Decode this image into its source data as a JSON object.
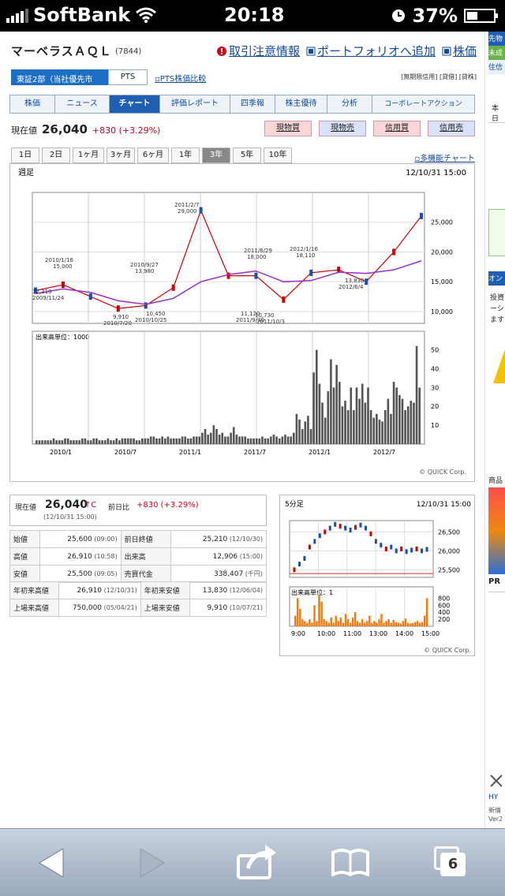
{
  "status": {
    "carrier": "SoftBank",
    "time": "20:18",
    "battery": "37%"
  },
  "stock": {
    "name": "マーベラスＡＱＬ",
    "code": "(7844)"
  },
  "toplinks": [
    "取引注意情報",
    "ポートフォリオへ追加",
    "株価"
  ],
  "market": {
    "active": "東証2部（当社優先市場）",
    "alt": "PTS",
    "compare": "PTS株価比較",
    "tags": "[無期限信用]  [貸借]  [貸株]"
  },
  "tabs": [
    "株価",
    "ニュース",
    "チャート",
    "評価レポート",
    "四季報",
    "株主優待",
    "分析",
    "コーポレートアクション"
  ],
  "price": {
    "label": "現在値",
    "value": "26,040",
    "change": "+830 (+3.29%)"
  },
  "trade_buttons": [
    "現物買",
    "現物売",
    "信用買",
    "信用売"
  ],
  "ranges": [
    "1日",
    "2日",
    "1ヶ月",
    "3ヶ月",
    "6ヶ月",
    "1年",
    "3年",
    "5年",
    "10年"
  ],
  "multi_chart": "多機能チャート",
  "weekly": {
    "label": "週足",
    "date": "12/10/31 15:00",
    "copyright": "© QUICK Corp.",
    "volume_label": "出来高単位：1000",
    "annotations": [
      "2011/2/7",
      "29,000",
      "2010/1/16",
      "15,000",
      "2010/9/27",
      "13,980",
      "2011/8/29",
      "18,000",
      "2012/1/16",
      "18,110",
      "12,310",
      "2009/11/24",
      "9,910",
      "2010/7/20",
      "10,450",
      "2010/10/25",
      "11,120",
      "2011/9/30",
      "10,730",
      "2011/10/3",
      "13,830",
      "2012/6/4"
    ]
  },
  "chart_data": [
    {
      "type": "line",
      "name": "weekly-price",
      "x": [
        "2009/11",
        "2010/1",
        "2010/4",
        "2010/7",
        "2010/10",
        "2011/1",
        "2011/2",
        "2011/4",
        "2011/7",
        "2011/10",
        "2012/1",
        "2012/4",
        "2012/6",
        "2012/8",
        "2012/10"
      ],
      "series": [
        {
          "values": [
            13500,
            14500,
            12500,
            10500,
            11000,
            14000,
            27000,
            16000,
            16000,
            12000,
            16500,
            17000,
            15000,
            20000,
            26040
          ]
        },
        {
          "values": [
            13000,
            13800,
            13200,
            11800,
            11200,
            12200,
            15000,
            16200,
            16800,
            15000,
            15200,
            16600,
            16400,
            17000,
            18500
          ]
        }
      ],
      "ylim": [
        8000,
        30000
      ],
      "yticks": [
        "25,000",
        "20,000",
        "15,000",
        "10,000"
      ],
      "xticks": [
        "2010/1",
        "2010/7",
        "2011/1",
        "2011/7",
        "2012/1",
        "2012/7"
      ]
    },
    {
      "type": "bar",
      "name": "weekly-volume",
      "values": [
        2,
        2,
        2,
        2,
        2,
        2,
        3,
        2,
        2,
        2,
        3,
        3,
        2,
        2,
        2,
        2,
        3,
        3,
        2,
        2,
        3,
        3,
        2,
        2,
        2,
        3,
        2,
        2,
        3,
        2,
        3,
        3,
        3,
        3,
        3,
        2,
        2,
        3,
        3,
        3,
        4,
        4,
        3,
        3,
        4,
        3,
        4,
        3,
        3,
        3,
        3,
        4,
        4,
        3,
        3,
        4,
        4,
        4,
        6,
        8,
        5,
        6,
        10,
        8,
        5,
        6,
        4,
        4,
        6,
        9,
        5,
        4,
        4,
        4,
        3,
        3,
        3,
        3,
        3,
        4,
        3,
        3,
        4,
        5,
        4,
        3,
        4,
        5,
        4,
        4,
        6,
        16,
        13,
        8,
        12,
        15,
        8,
        38,
        50,
        32,
        22,
        14,
        28,
        45,
        30,
        42,
        33,
        20,
        23,
        18,
        30,
        18,
        30,
        24,
        32,
        22,
        30,
        18,
        14,
        16,
        13,
        12,
        18,
        24,
        16,
        33,
        30,
        26,
        24,
        18,
        20,
        23,
        22,
        52,
        30
      ],
      "ylim": [
        0,
        54
      ],
      "yticks": [
        "50",
        "40",
        "30",
        "20",
        "10"
      ]
    },
    {
      "type": "line",
      "name": "5min-price",
      "values": [
        25500,
        25650,
        25800,
        26100,
        26250,
        26400,
        26500,
        26600,
        26700,
        26650,
        26600,
        26550,
        26620,
        26680,
        26600,
        26450,
        26250,
        26150,
        26050,
        26100,
        26000,
        26050,
        25980,
        26020,
        26050,
        26000,
        26040
      ],
      "ylim": [
        25300,
        26800
      ],
      "yticks": [
        "26,500",
        "26,000",
        "25,500"
      ],
      "xticks": [
        "9:00",
        "10:00",
        "11:00",
        "13:00",
        "14:00",
        "15:00"
      ]
    },
    {
      "type": "bar",
      "name": "5min-volume",
      "values": [
        300,
        800,
        500,
        200,
        150,
        100,
        200,
        100,
        600,
        150,
        900,
        700,
        200,
        150,
        100,
        250,
        100,
        300,
        150,
        250,
        100,
        350,
        200,
        100,
        250,
        400,
        150,
        100,
        200,
        100,
        150,
        300,
        100,
        150,
        100,
        200,
        350,
        100,
        150,
        200,
        100,
        180,
        120,
        100,
        80,
        150,
        220,
        100,
        80,
        90,
        120,
        150,
        100,
        120,
        300,
        800
      ],
      "ylim": [
        0,
        900
      ],
      "yticks": [
        "800",
        "600",
        "400",
        "200"
      ]
    }
  ],
  "quote": {
    "now_label": "現在値",
    "now": "26,040",
    "mark": "↑C",
    "time": "(12/10/31 15:00)",
    "prev_label": "前日比",
    "prev": "+830 (+3.29%)"
  },
  "table1": [
    {
      "l1": "始値",
      "v1": "25,600",
      "t1": "(09:00)",
      "l2": "前日終値",
      "v2": "25,210",
      "t2": "(12/10/30)"
    },
    {
      "l1": "高値",
      "v1": "26,910",
      "t1": "(10:58)",
      "l2": "出来高",
      "v2": "12,906",
      "t2": "(15:00)"
    },
    {
      "l1": "安値",
      "v1": "25,500",
      "t1": "(09:05)",
      "l2": "売買代金",
      "v2": "338,407",
      "t2": "(千円)"
    }
  ],
  "table2": [
    {
      "l1": "年初来高値",
      "v1": "26,910",
      "t1": "(12/10/31)",
      "l2": "年初来安値",
      "v2": "13,830",
      "t2": "(12/06/04)"
    },
    {
      "l1": "上場来高値",
      "v1": "750,000",
      "t1": "(05/04/21)",
      "l2": "上場来安値",
      "v2": "9,910",
      "t2": "(10/07/21)"
    }
  ],
  "min5": {
    "label": "5分足",
    "date": "12/10/31 15:00",
    "volume_label": "出来高単位：1",
    "copyright": "© QUICK Corp."
  },
  "sidebar": {
    "top": [
      "先物",
      "未成",
      "住信"
    ],
    "texts": [
      "本日",
      "投資",
      "ーシ",
      "ます",
      "オン",
      "商品",
      "PR",
      "HY",
      "新情",
      "Ver2"
    ]
  },
  "toolbar": {
    "tabs_count": "6",
    "accent": "#2b6fd6"
  }
}
